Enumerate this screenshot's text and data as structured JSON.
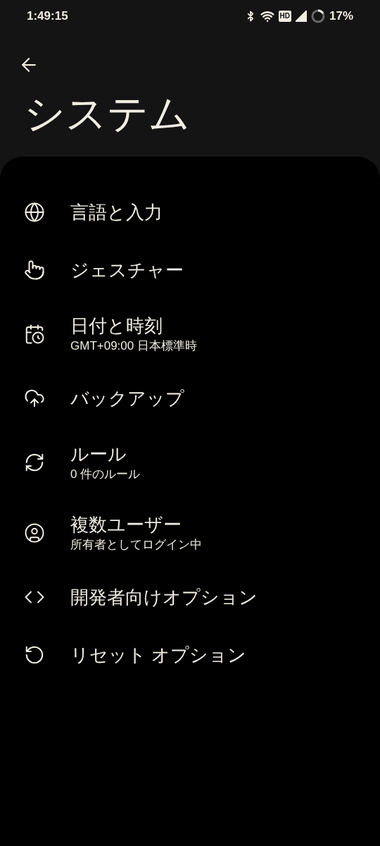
{
  "status_bar": {
    "time": "1:49:15",
    "hd_badge": "HD",
    "battery": "17%"
  },
  "title": "システム",
  "items": [
    {
      "title": "言語と入力"
    },
    {
      "title": "ジェスチャー"
    },
    {
      "title": "日付と時刻",
      "subtitle": "GMT+09:00 日本標準時"
    },
    {
      "title": "バックアップ"
    },
    {
      "title": "ルール",
      "subtitle": "0 件のルール"
    },
    {
      "title": "複数ユーザー",
      "subtitle": "所有者としてログイン中"
    },
    {
      "title": "開発者向けオプション"
    },
    {
      "title": "リセット オプション"
    }
  ]
}
